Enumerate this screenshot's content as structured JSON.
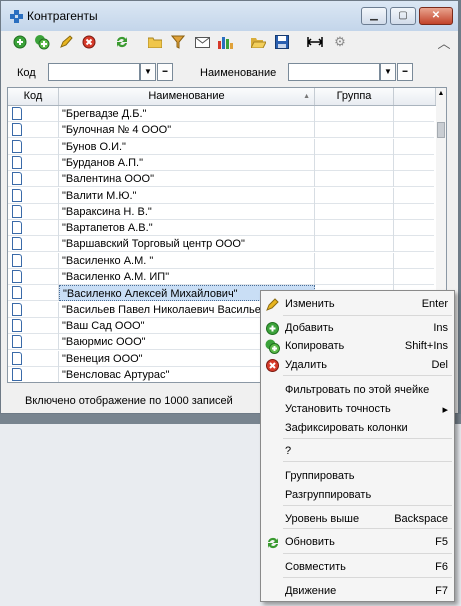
{
  "window": {
    "title": "Контрагенты",
    "buttons": [
      "minimize",
      "maximize",
      "close"
    ]
  },
  "toolbar": {
    "icons": [
      "add-icon",
      "copy-icon",
      "edit-icon",
      "delete-icon",
      "refresh-icon",
      "folder-icon",
      "filter-icon",
      "mail-icon",
      "chart-icon",
      "open-folder-icon",
      "save-icon",
      "fit-width-icon",
      "settings-icon",
      "collapse-icon"
    ]
  },
  "filters": {
    "code_label": "Код",
    "name_label": "Наименование",
    "code_value": "",
    "name_value": ""
  },
  "grid": {
    "columns": [
      "Код",
      "Наименование",
      "Группа"
    ],
    "rows": [
      "\"Брегвадзе Д.Б.\"",
      "\"Булочная № 4 ООО\"",
      "\"Бунов О.И.\"",
      "\"Бурданов А.П.\"",
      "\"Валентина ООО\"",
      "\"Валити М.Ю.\"",
      "\"Вараксина Н. В.\"",
      "\"Вартапетов А.В.\"",
      "\"Варшавский Торговый центр ООО\"",
      "\"Василенко А.М. \"",
      "\"Василенко А.М. ИП\"",
      "\"Василенко Алексей Михайлович\"",
      "\"Васильев Павел Николаевич Васильев",
      "\"Ваш Сад  ООО\"",
      "\"Ваюрмис ООО\"",
      "\"Венеция ООО\"",
      "\"Венсловас Артурас\""
    ],
    "selected_row": 11
  },
  "status": {
    "text": "Включено отображение по 1000 записей"
  },
  "context_menu": {
    "items": [
      {
        "label": "Изменить",
        "shortcut": "Enter",
        "icon": "edit-icon"
      },
      {
        "label": "Добавить",
        "shortcut": "Ins",
        "icon": "add-icon"
      },
      {
        "label": "Копировать",
        "shortcut": "Shift+Ins",
        "icon": "copy-icon"
      },
      {
        "label": "Удалить",
        "shortcut": "Del",
        "icon": "delete-icon"
      },
      {
        "label": "Фильтровать по этой ячейке",
        "shortcut": "",
        "icon": ""
      },
      {
        "label": "Установить точность",
        "shortcut": "▸",
        "icon": ""
      },
      {
        "label": "Зафиксировать колонки",
        "shortcut": "",
        "icon": ""
      },
      {
        "label": "?",
        "shortcut": "",
        "icon": ""
      },
      {
        "label": "Группировать",
        "shortcut": "",
        "icon": ""
      },
      {
        "label": "Разгруппировать",
        "shortcut": "",
        "icon": ""
      },
      {
        "label": "Уровень выше",
        "shortcut": "Backspace",
        "icon": ""
      },
      {
        "label": "Обновить",
        "shortcut": "F5",
        "icon": "refresh-icon"
      },
      {
        "label": "Совместить",
        "shortcut": "F6",
        "icon": ""
      },
      {
        "label": "Движение",
        "shortcut": "F7",
        "icon": ""
      }
    ]
  }
}
